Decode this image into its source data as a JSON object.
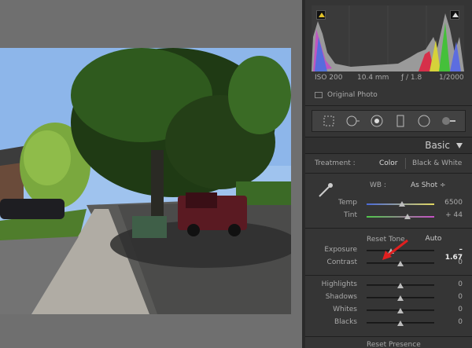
{
  "histogram": {
    "info": {
      "iso": "ISO 200",
      "focal": "10.4 mm",
      "aperture": "ƒ / 1.8",
      "shutter": "1/2000"
    },
    "original_photo_label": "Original Photo"
  },
  "basic": {
    "title": "Basic",
    "treatment_label": "Treatment :",
    "color_label": "Color",
    "bw_label": "Black & White",
    "wb_label": "WB :",
    "wb_value": "As Shot ÷",
    "reset_tone": "Reset Tone",
    "auto": "Auto",
    "reset_presence": "Reset Presence",
    "sliders": [
      {
        "label": "Temp",
        "value": "6500",
        "pos": 0.52
      },
      {
        "label": "Tint",
        "value": "+ 44",
        "pos": 0.6
      },
      {
        "label": "Exposure",
        "value": "– 1.67",
        "pos": 0.36
      },
      {
        "label": "Contrast",
        "value": "0",
        "pos": 0.5
      },
      {
        "label": "Highlights",
        "value": "0",
        "pos": 0.5
      },
      {
        "label": "Shadows",
        "value": "0",
        "pos": 0.5
      },
      {
        "label": "Whites",
        "value": "0",
        "pos": 0.5
      },
      {
        "label": "Blacks",
        "value": "0",
        "pos": 0.5
      }
    ]
  }
}
